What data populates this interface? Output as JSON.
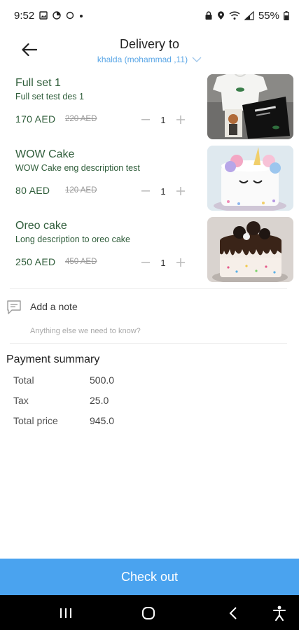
{
  "status_bar": {
    "time": "9:52",
    "battery": "55%"
  },
  "header": {
    "title": "Delivery to",
    "subtitle": "khalda (mohammad ,11)"
  },
  "items": [
    {
      "name": "Full set 1",
      "description": "Full set test des 1",
      "price": "170  AED",
      "old_price": "220 AED",
      "quantity": "1",
      "image_icon": "clothing-set-photo"
    },
    {
      "name": "WOW Cake",
      "description": "WOW Cake eng description test",
      "price": "80  AED",
      "old_price": "120 AED",
      "quantity": "1",
      "image_icon": "unicorn-cake-photo"
    },
    {
      "name": "Oreo cake",
      "description": "Long description to oreo cake",
      "price": "250  AED",
      "old_price": "450 AED",
      "quantity": "1",
      "image_icon": "oreo-cake-photo"
    }
  ],
  "note": {
    "label": "Add a note",
    "placeholder": "Anything else we need to know?"
  },
  "payment": {
    "title": "Payment summary",
    "rows": [
      {
        "label": "Total",
        "value": "500.0"
      },
      {
        "label": "Tax",
        "value": "25.0"
      },
      {
        "label": "Total price",
        "value": "945.0"
      }
    ]
  },
  "checkout": {
    "label": "Check out"
  },
  "colors": {
    "accent": "#4aa3ef",
    "item_text": "#2f5d3a",
    "link": "#5aa6e6"
  }
}
